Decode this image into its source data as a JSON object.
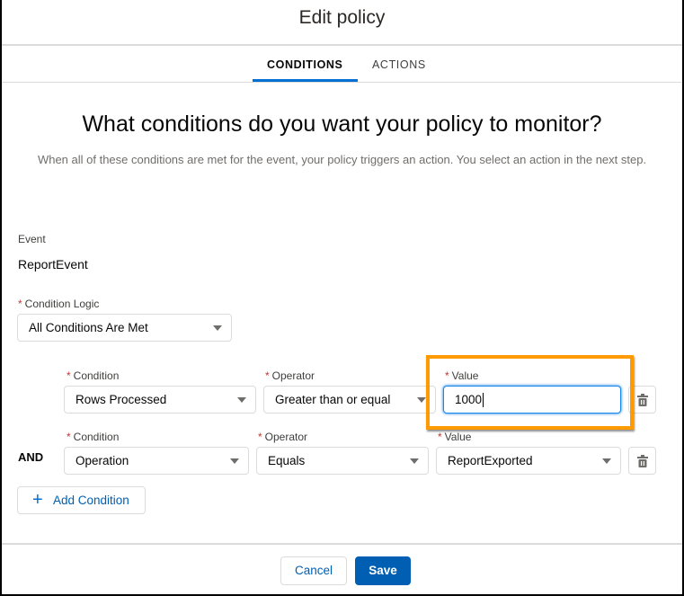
{
  "modal": {
    "title": "Edit policy",
    "tabs": [
      {
        "label": "CONDITIONS",
        "active": true
      },
      {
        "label": "ACTIONS",
        "active": false
      }
    ]
  },
  "content": {
    "heading": "What conditions do you want your policy to monitor?",
    "description": "When all of these conditions are met for the event, your policy triggers an action. You select an action in the next step."
  },
  "event": {
    "label": "Event",
    "value": "ReportEvent"
  },
  "condition_logic": {
    "required_mark": "*",
    "label": "Condition Logic",
    "value": "All Conditions Are Met"
  },
  "conditions": [
    {
      "connector": "",
      "condition_label": "Condition",
      "condition_value": "Rows Processed",
      "operator_label": "Operator",
      "operator_value": "Greater than or equal",
      "value_label": "Value",
      "value_value": "1000",
      "value_type": "text-input"
    },
    {
      "connector": "AND",
      "condition_label": "Condition",
      "condition_value": "Operation",
      "operator_label": "Operator",
      "operator_value": "Equals",
      "value_label": "Value",
      "value_value": "ReportExported",
      "value_type": "select"
    }
  ],
  "buttons": {
    "add_condition": "Add Condition",
    "cancel": "Cancel",
    "save": "Save"
  },
  "colors": {
    "brand": "#005fb2",
    "tab_underline": "#0070d2",
    "highlight": "#ff9a00",
    "required": "#c23934"
  },
  "icons": {
    "delete": "trash-icon",
    "dropdown": "chevron-down-icon",
    "add": "plus-icon"
  }
}
